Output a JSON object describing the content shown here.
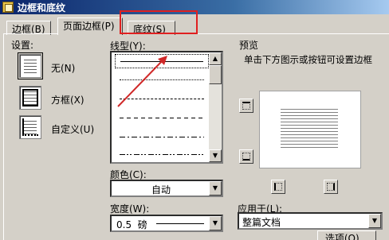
{
  "window": {
    "title": "边框和底纹"
  },
  "tabs": [
    {
      "label": "边框(B)"
    },
    {
      "label": "页面边框(P)"
    },
    {
      "label": "底纹(S)"
    }
  ],
  "setting": {
    "label": "设置:",
    "options": [
      {
        "label": "无(N)"
      },
      {
        "label": "方框(X)"
      },
      {
        "label": "自定义(U)"
      }
    ]
  },
  "line_style": {
    "label": "线型(Y):"
  },
  "color": {
    "label": "颜色(C):",
    "value": "自动"
  },
  "width": {
    "label": "宽度(W):",
    "value": "0.5  磅"
  },
  "preview": {
    "label": "预览",
    "hint": "单击下方图示或按钮可设置边框"
  },
  "apply_to": {
    "label": "应用于(L):",
    "value": "整篇文档"
  },
  "options_button": {
    "label": "选项(O)..."
  },
  "colors": {
    "title_bar_start": "#0a246a",
    "highlight": "#e02020",
    "annotation_arrow": "#d02828",
    "dialog_bg": "#d4d0c8"
  }
}
